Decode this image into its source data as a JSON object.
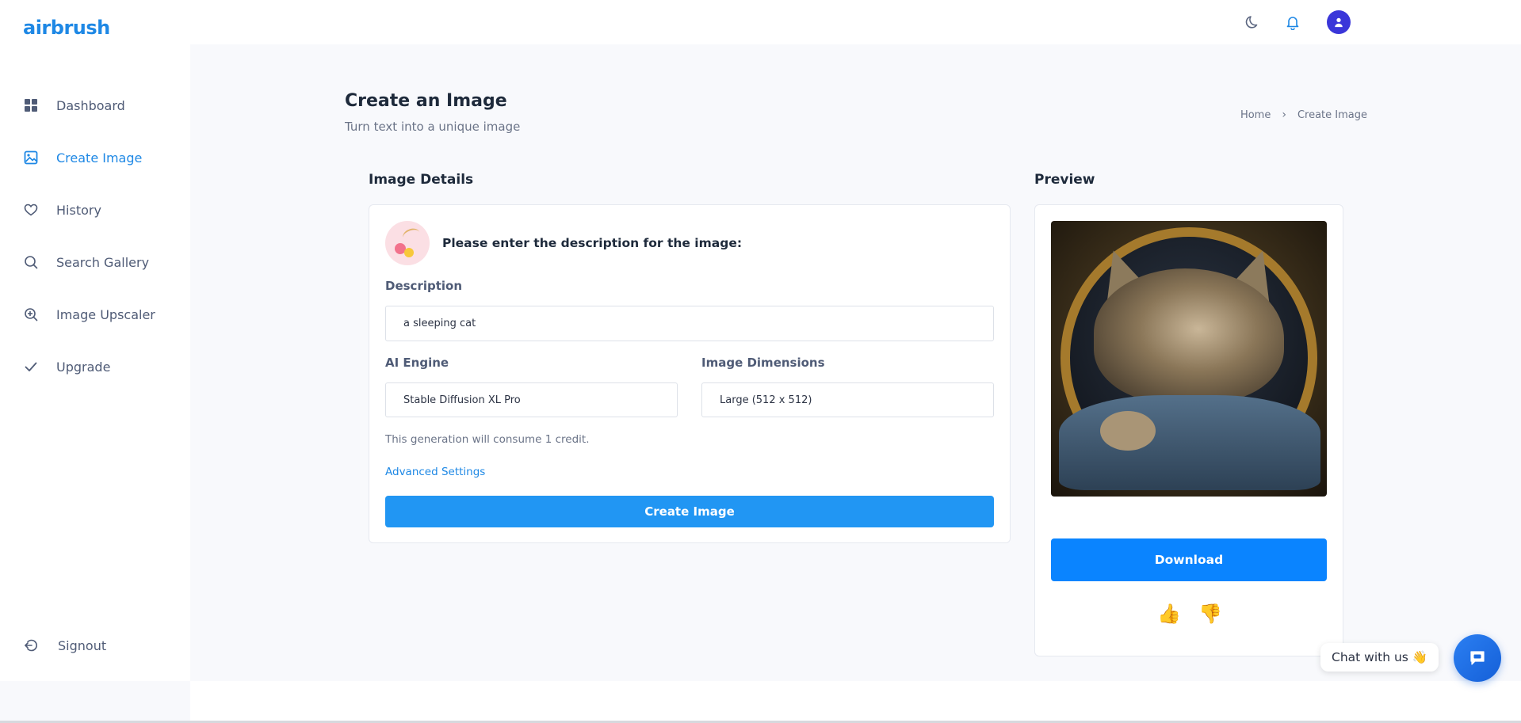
{
  "brand": {
    "logo": "airbrush",
    "accent": "#1e88e5"
  },
  "sidebar": {
    "items": [
      {
        "label": "Dashboard",
        "icon": "grid-icon",
        "active": false
      },
      {
        "label": "Create Image",
        "icon": "image-icon",
        "active": true
      },
      {
        "label": "History",
        "icon": "heart-icon",
        "active": false
      },
      {
        "label": "Search Gallery",
        "icon": "search-icon",
        "active": false
      },
      {
        "label": "Image Upscaler",
        "icon": "zoom-in-icon",
        "active": false
      },
      {
        "label": "Upgrade",
        "icon": "check-icon",
        "active": false
      }
    ],
    "signout": "Signout"
  },
  "topbar": {
    "icons": [
      "moon-icon",
      "bell-icon",
      "user-avatar-icon"
    ]
  },
  "header": {
    "title": "Create an Image",
    "subtitle": "Turn text into a unique image",
    "breadcrumb": {
      "home": "Home",
      "current": "Create Image"
    }
  },
  "details": {
    "section_title": "Image Details",
    "prompt_heading": "Please enter the description for the image:",
    "description_label": "Description",
    "description_value": "a sleeping cat",
    "engine_label": "AI Engine",
    "engine_value": "Stable Diffusion XL Pro",
    "dimensions_label": "Image Dimensions",
    "dimensions_value": "Large (512 x 512)",
    "credit_note": "This generation will consume 1 credit.",
    "advanced_link": "Advanced Settings",
    "create_button": "Create Image"
  },
  "preview": {
    "section_title": "Preview",
    "download_button": "Download",
    "thumbs_up": "👍",
    "thumbs_down": "👎"
  },
  "chat": {
    "label": "Chat with us 👋"
  }
}
